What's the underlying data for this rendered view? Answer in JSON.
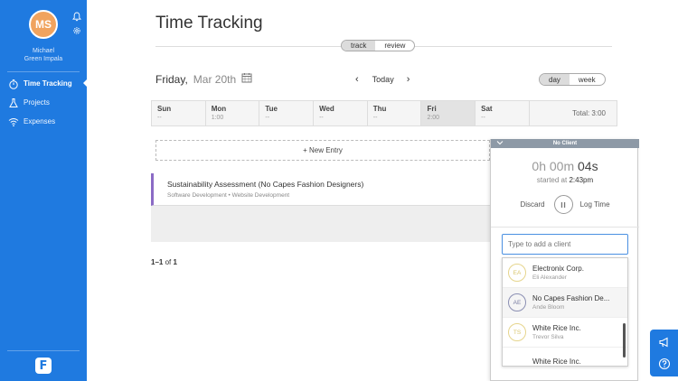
{
  "user": {
    "initials": "MS",
    "first_name": "Michael",
    "last_name": "Green Impala"
  },
  "nav": {
    "items": [
      {
        "label": "Time Tracking",
        "icon": "stopwatch-icon",
        "active": true
      },
      {
        "label": "Projects",
        "icon": "flask-icon",
        "active": false
      },
      {
        "label": "Expenses",
        "icon": "wifi-icon",
        "active": false
      }
    ]
  },
  "page": {
    "title": "Time Tracking"
  },
  "mode_toggle": {
    "track": "track",
    "review": "review",
    "selected": "track"
  },
  "date": {
    "weekday": "Friday,",
    "date": "Mar 20th",
    "today": "Today"
  },
  "range_toggle": {
    "day": "day",
    "week": "week",
    "selected": "day"
  },
  "week": {
    "days": [
      {
        "name": "Sun",
        "value": "--"
      },
      {
        "name": "Mon",
        "value": "1:00"
      },
      {
        "name": "Tue",
        "value": "--"
      },
      {
        "name": "Wed",
        "value": "--"
      },
      {
        "name": "Thu",
        "value": "--"
      },
      {
        "name": "Fri",
        "value": "2:00",
        "selected": true
      },
      {
        "name": "Sat",
        "value": "--"
      }
    ],
    "total": "Total: 3:00"
  },
  "new_entry": "+ New Entry",
  "entry": {
    "title": "Sustainability Assessment (No Capes Fashion Designers)",
    "subtitle": "Software Development • Website Development"
  },
  "pager": {
    "range": "1–1",
    "of": "of",
    "total": "1"
  },
  "timer": {
    "header": "No Client",
    "hours": "0h",
    "minutes": "00m",
    "seconds": "04s",
    "started_prefix": "started at",
    "started_time": "2:43pm",
    "discard": "Discard",
    "log_time": "Log Time",
    "client_placeholder": "Type to add a client",
    "clients": [
      {
        "initials": "EA",
        "name": "Electronix Corp.",
        "contact": "Eli Alexander",
        "color": "#d9c66d"
      },
      {
        "initials": "AE",
        "name": "No Capes Fashion De...",
        "contact": "Ande Bloom",
        "color": "#7a7ea3"
      },
      {
        "initials": "TS",
        "name": "White Rice Inc.",
        "contact": "Trevor Silva",
        "color": "#d9c66d"
      },
      {
        "initials": "",
        "name": "White Rice Inc.",
        "contact": "",
        "color": "#d9c66d"
      }
    ]
  },
  "colors": {
    "sidebar": "#1f7ae0",
    "avatar": "#f0a35e",
    "entry_accent": "#8b6bc5"
  }
}
